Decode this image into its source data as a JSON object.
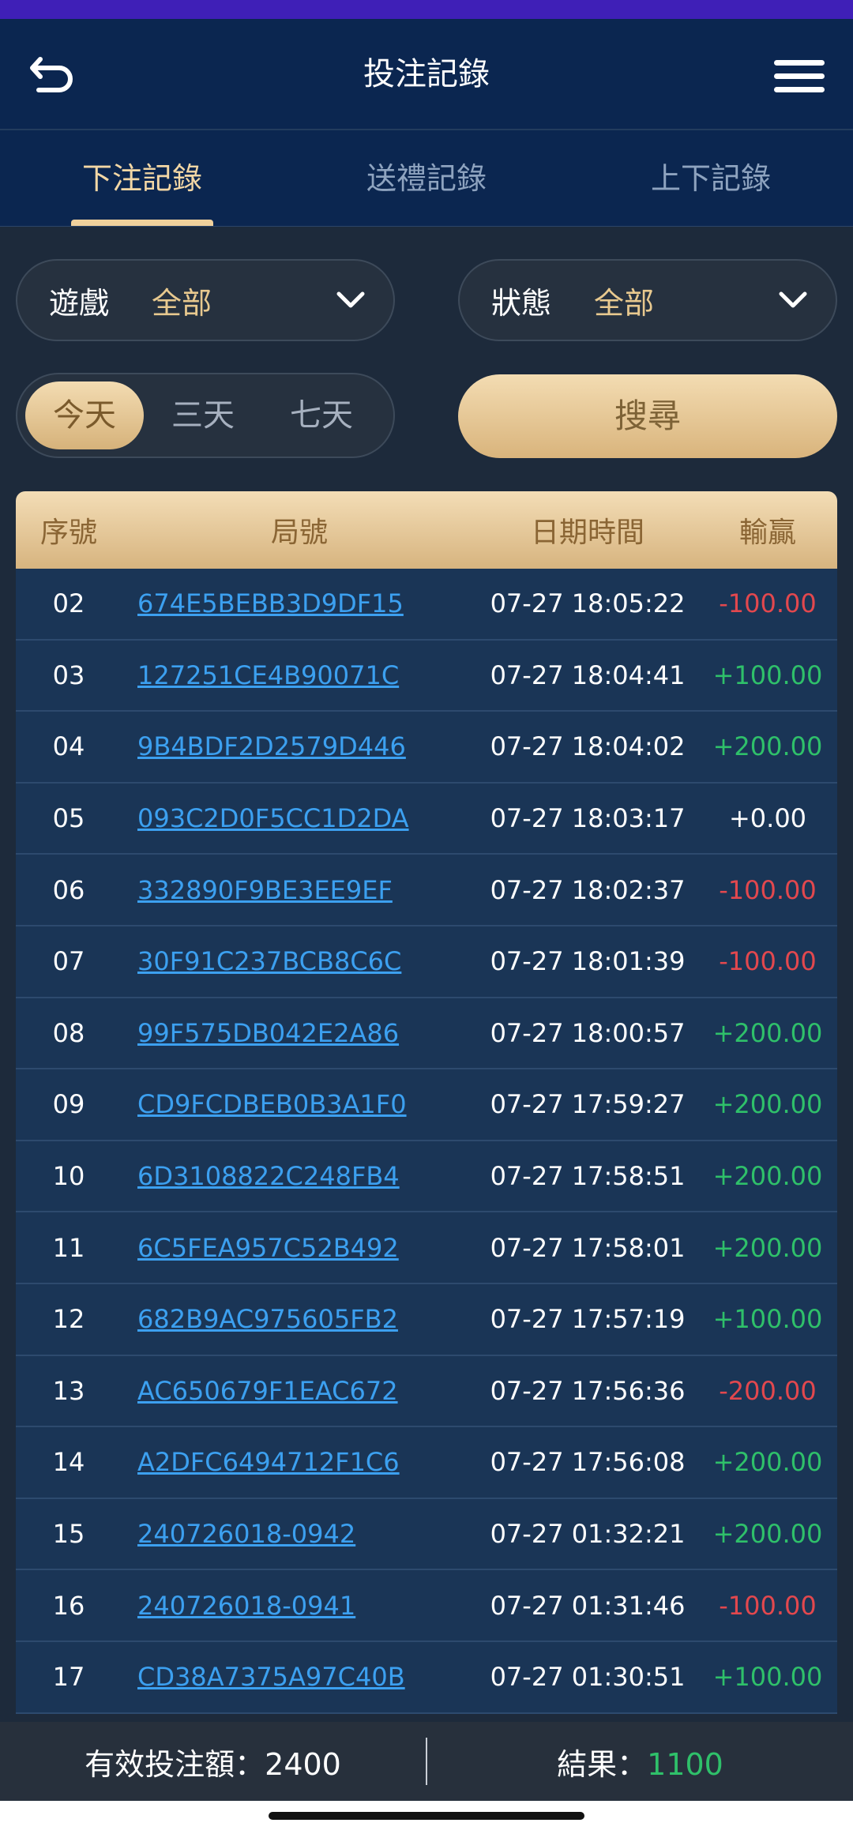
{
  "header": {
    "title": "投注記錄",
    "back_icon": "back-arrow-icon",
    "menu_icon": "hamburger-menu-icon"
  },
  "tabs": [
    {
      "label": "下注記錄",
      "active": true
    },
    {
      "label": "送禮記錄",
      "active": false
    },
    {
      "label": "上下記錄",
      "active": false
    }
  ],
  "filters": {
    "game": {
      "label": "遊戲",
      "value": "全部"
    },
    "status": {
      "label": "狀態",
      "value": "全部"
    }
  },
  "ranges": [
    {
      "label": "今天",
      "active": true
    },
    {
      "label": "三天",
      "active": false
    },
    {
      "label": "七天",
      "active": false
    }
  ],
  "search_label": "搜尋",
  "table": {
    "headers": {
      "idx": "序號",
      "round": "局號",
      "time": "日期時間",
      "win": "輸贏"
    },
    "rows": [
      {
        "idx": "02",
        "round": "674E5BEBB3D9DF15",
        "time": "07-27 18:05:22",
        "win": "-100.00",
        "sign": "neg"
      },
      {
        "idx": "03",
        "round": "127251CE4B90071C",
        "time": "07-27 18:04:41",
        "win": "+100.00",
        "sign": "pos"
      },
      {
        "idx": "04",
        "round": "9B4BDF2D2579D446",
        "time": "07-27 18:04:02",
        "win": "+200.00",
        "sign": "pos"
      },
      {
        "idx": "05",
        "round": "093C2D0F5CC1D2DA",
        "time": "07-27 18:03:17",
        "win": "+0.00",
        "sign": "zero"
      },
      {
        "idx": "06",
        "round": "332890F9BE3EE9EF",
        "time": "07-27 18:02:37",
        "win": "-100.00",
        "sign": "neg"
      },
      {
        "idx": "07",
        "round": "30F91C237BCB8C6C",
        "time": "07-27 18:01:39",
        "win": "-100.00",
        "sign": "neg"
      },
      {
        "idx": "08",
        "round": "99F575DB042E2A86",
        "time": "07-27 18:00:57",
        "win": "+200.00",
        "sign": "pos"
      },
      {
        "idx": "09",
        "round": "CD9FCDBEB0B3A1F0",
        "time": "07-27 17:59:27",
        "win": "+200.00",
        "sign": "pos"
      },
      {
        "idx": "10",
        "round": "6D3108822C248FB4",
        "time": "07-27 17:58:51",
        "win": "+200.00",
        "sign": "pos"
      },
      {
        "idx": "11",
        "round": "6C5FEA957C52B492",
        "time": "07-27 17:58:01",
        "win": "+200.00",
        "sign": "pos"
      },
      {
        "idx": "12",
        "round": "682B9AC975605FB2",
        "time": "07-27 17:57:19",
        "win": "+100.00",
        "sign": "pos"
      },
      {
        "idx": "13",
        "round": "AC650679F1EAC672",
        "time": "07-27 17:56:36",
        "win": "-200.00",
        "sign": "neg"
      },
      {
        "idx": "14",
        "round": "A2DFC6494712F1C6",
        "time": "07-27 17:56:08",
        "win": "+200.00",
        "sign": "pos"
      },
      {
        "idx": "15",
        "round": "240726018-0942",
        "time": "07-27 01:32:21",
        "win": "+200.00",
        "sign": "pos"
      },
      {
        "idx": "16",
        "round": "240726018-0941",
        "time": "07-27 01:31:46",
        "win": "-100.00",
        "sign": "neg"
      },
      {
        "idx": "17",
        "round": "CD38A7375A97C40B",
        "time": "07-27 01:30:51",
        "win": "+100.00",
        "sign": "pos"
      }
    ]
  },
  "footer": {
    "valid_bet_label": "有效投注額：",
    "valid_bet_value": "2400",
    "result_label": "結果：",
    "result_value": "1100"
  },
  "colors": {
    "accent_gold": "#e8c98f",
    "positive": "#2fc06a",
    "negative": "#e2484e",
    "link": "#3ca0f0"
  }
}
